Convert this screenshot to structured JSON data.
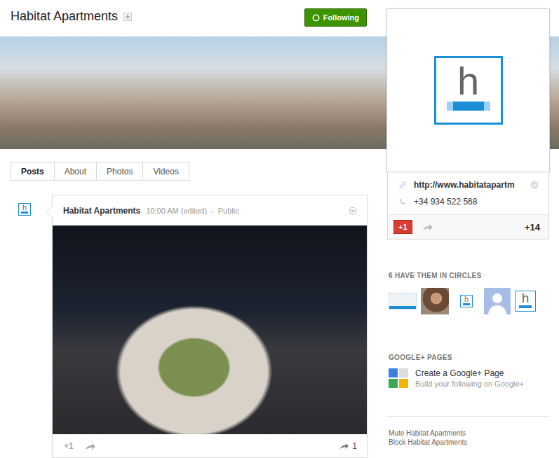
{
  "page": {
    "title": "Habitat Apartments",
    "follow_button": "Following"
  },
  "tabs": [
    {
      "label": "Posts",
      "selected": true
    },
    {
      "label": "About",
      "selected": false
    },
    {
      "label": "Photos",
      "selected": false
    },
    {
      "label": "Videos",
      "selected": false
    }
  ],
  "profile": {
    "logo": "h",
    "website": "http://www.habitatapartm",
    "phone": "+34 934 522 568",
    "plus_one": "+1",
    "plus_count": "+14"
  },
  "post": {
    "author": "Habitat Apartments",
    "time": "10:00 AM (edited)",
    "separator": "-",
    "visibility": "Public",
    "plus_one": "+1",
    "shares": "1"
  },
  "circles": {
    "heading": "6 HAVE THEM IN CIRCLES",
    "avatars": [
      {
        "kind": "wide-logo"
      },
      {
        "kind": "photo"
      },
      {
        "kind": "small-logo"
      },
      {
        "kind": "default"
      },
      {
        "kind": "logo"
      }
    ]
  },
  "pages": {
    "heading": "GOOGLE+ PAGES",
    "link": "Create a Google+ Page",
    "subtitle": "Build your following on Google+"
  },
  "footer_links": [
    "Mute Habitat Apartments",
    "Block Habitat Apartments"
  ]
}
